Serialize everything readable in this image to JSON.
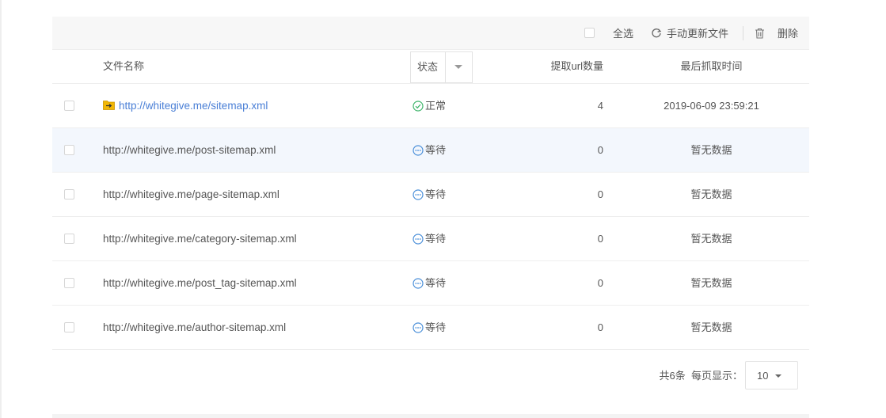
{
  "toolbar": {
    "select_all_label": "全选",
    "refresh_label": "手动更新文件",
    "delete_label": "删除"
  },
  "columns": {
    "name": "文件名称",
    "status": "状态",
    "count": "提取url数量",
    "time": "最后抓取时间"
  },
  "rows": [
    {
      "url": "http://whitegive.me/sitemap.xml",
      "status": "正常",
      "status_icon": "check-circle-icon",
      "count": "4",
      "time": "2019-06-09 23:59:21"
    },
    {
      "url": "http://whitegive.me/post-sitemap.xml",
      "status": "等待",
      "status_icon": "pending-icon",
      "count": "0",
      "time": "暂无数据"
    },
    {
      "url": "http://whitegive.me/page-sitemap.xml",
      "status": "等待",
      "status_icon": "pending-icon",
      "count": "0",
      "time": "暂无数据"
    },
    {
      "url": "http://whitegive.me/category-sitemap.xml",
      "status": "等待",
      "status_icon": "pending-icon",
      "count": "0",
      "time": "暂无数据"
    },
    {
      "url": "http://whitegive.me/post_tag-sitemap.xml",
      "status": "等待",
      "status_icon": "pending-icon",
      "count": "0",
      "time": "暂无数据"
    },
    {
      "url": "http://whitegive.me/author-sitemap.xml",
      "status": "等待",
      "status_icon": "pending-icon",
      "count": "0",
      "time": "暂无数据"
    }
  ],
  "pager": {
    "total_label": "共6条",
    "per_page_label": "每页显示：",
    "page_size": "10"
  },
  "colors": {
    "link": "#4a7fd6",
    "ok_green": "#3fb56b",
    "pending_blue": "#4a8fd9",
    "highlight_row": "#f3f7fd"
  }
}
